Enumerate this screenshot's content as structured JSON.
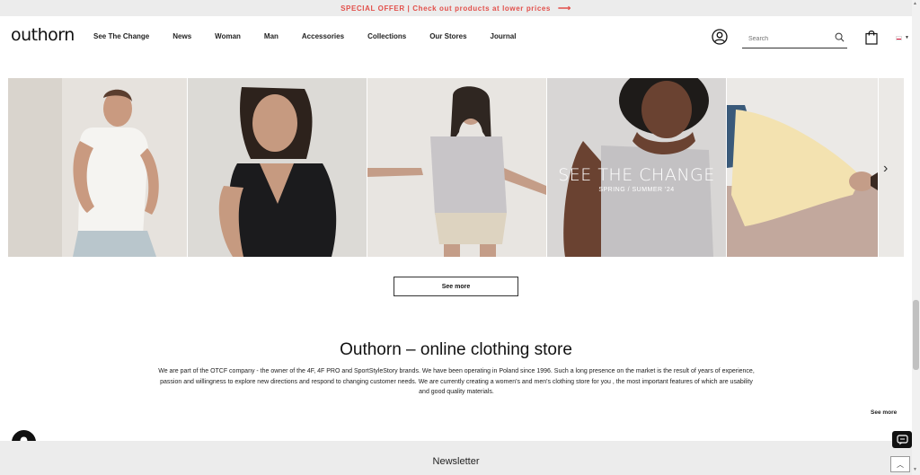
{
  "promo": {
    "text": "SPECIAL OFFER | Check out products at lower prices",
    "arrow": "⟶"
  },
  "header": {
    "logo": "outhorn",
    "nav": [
      "See The Change",
      "News",
      "Woman",
      "Man",
      "Accessories",
      "Collections",
      "Our Stores",
      "Journal"
    ],
    "search_placeholder": "Search"
  },
  "carousel": {
    "campaign_title": "SEE THE CHANGE",
    "campaign_subtitle": "SPRING / SUMMER '24",
    "next_arrow": "›"
  },
  "buttons": {
    "see_more": "See more"
  },
  "store": {
    "title": "Outhorn – online clothing store",
    "description_line1": "We are part of the OTCF company - the owner of the 4F, 4F PRO and SportStyleStory brands. We have been operating in Poland since 1996. Such a long presence on the market is the result of years of experience,",
    "description_line2": "passion and willingness to explore new directions and respond to changing customer needs. We are currently creating a  women's and men's clothing store for you , the most important features of which are usability",
    "description_line3": "and good quality materials.",
    "see_more_link": "See more"
  },
  "newsletter": {
    "title": "Newsletter"
  },
  "icons": [
    "account-icon",
    "search-icon",
    "bag-icon",
    "flag-pl-icon",
    "bell-icon",
    "chat-icon",
    "chevron-right-icon",
    "chevron-up-icon"
  ],
  "colors": {
    "promo_text": "#e2504b",
    "promo_bg": "#ececec",
    "dark": "#111111"
  }
}
